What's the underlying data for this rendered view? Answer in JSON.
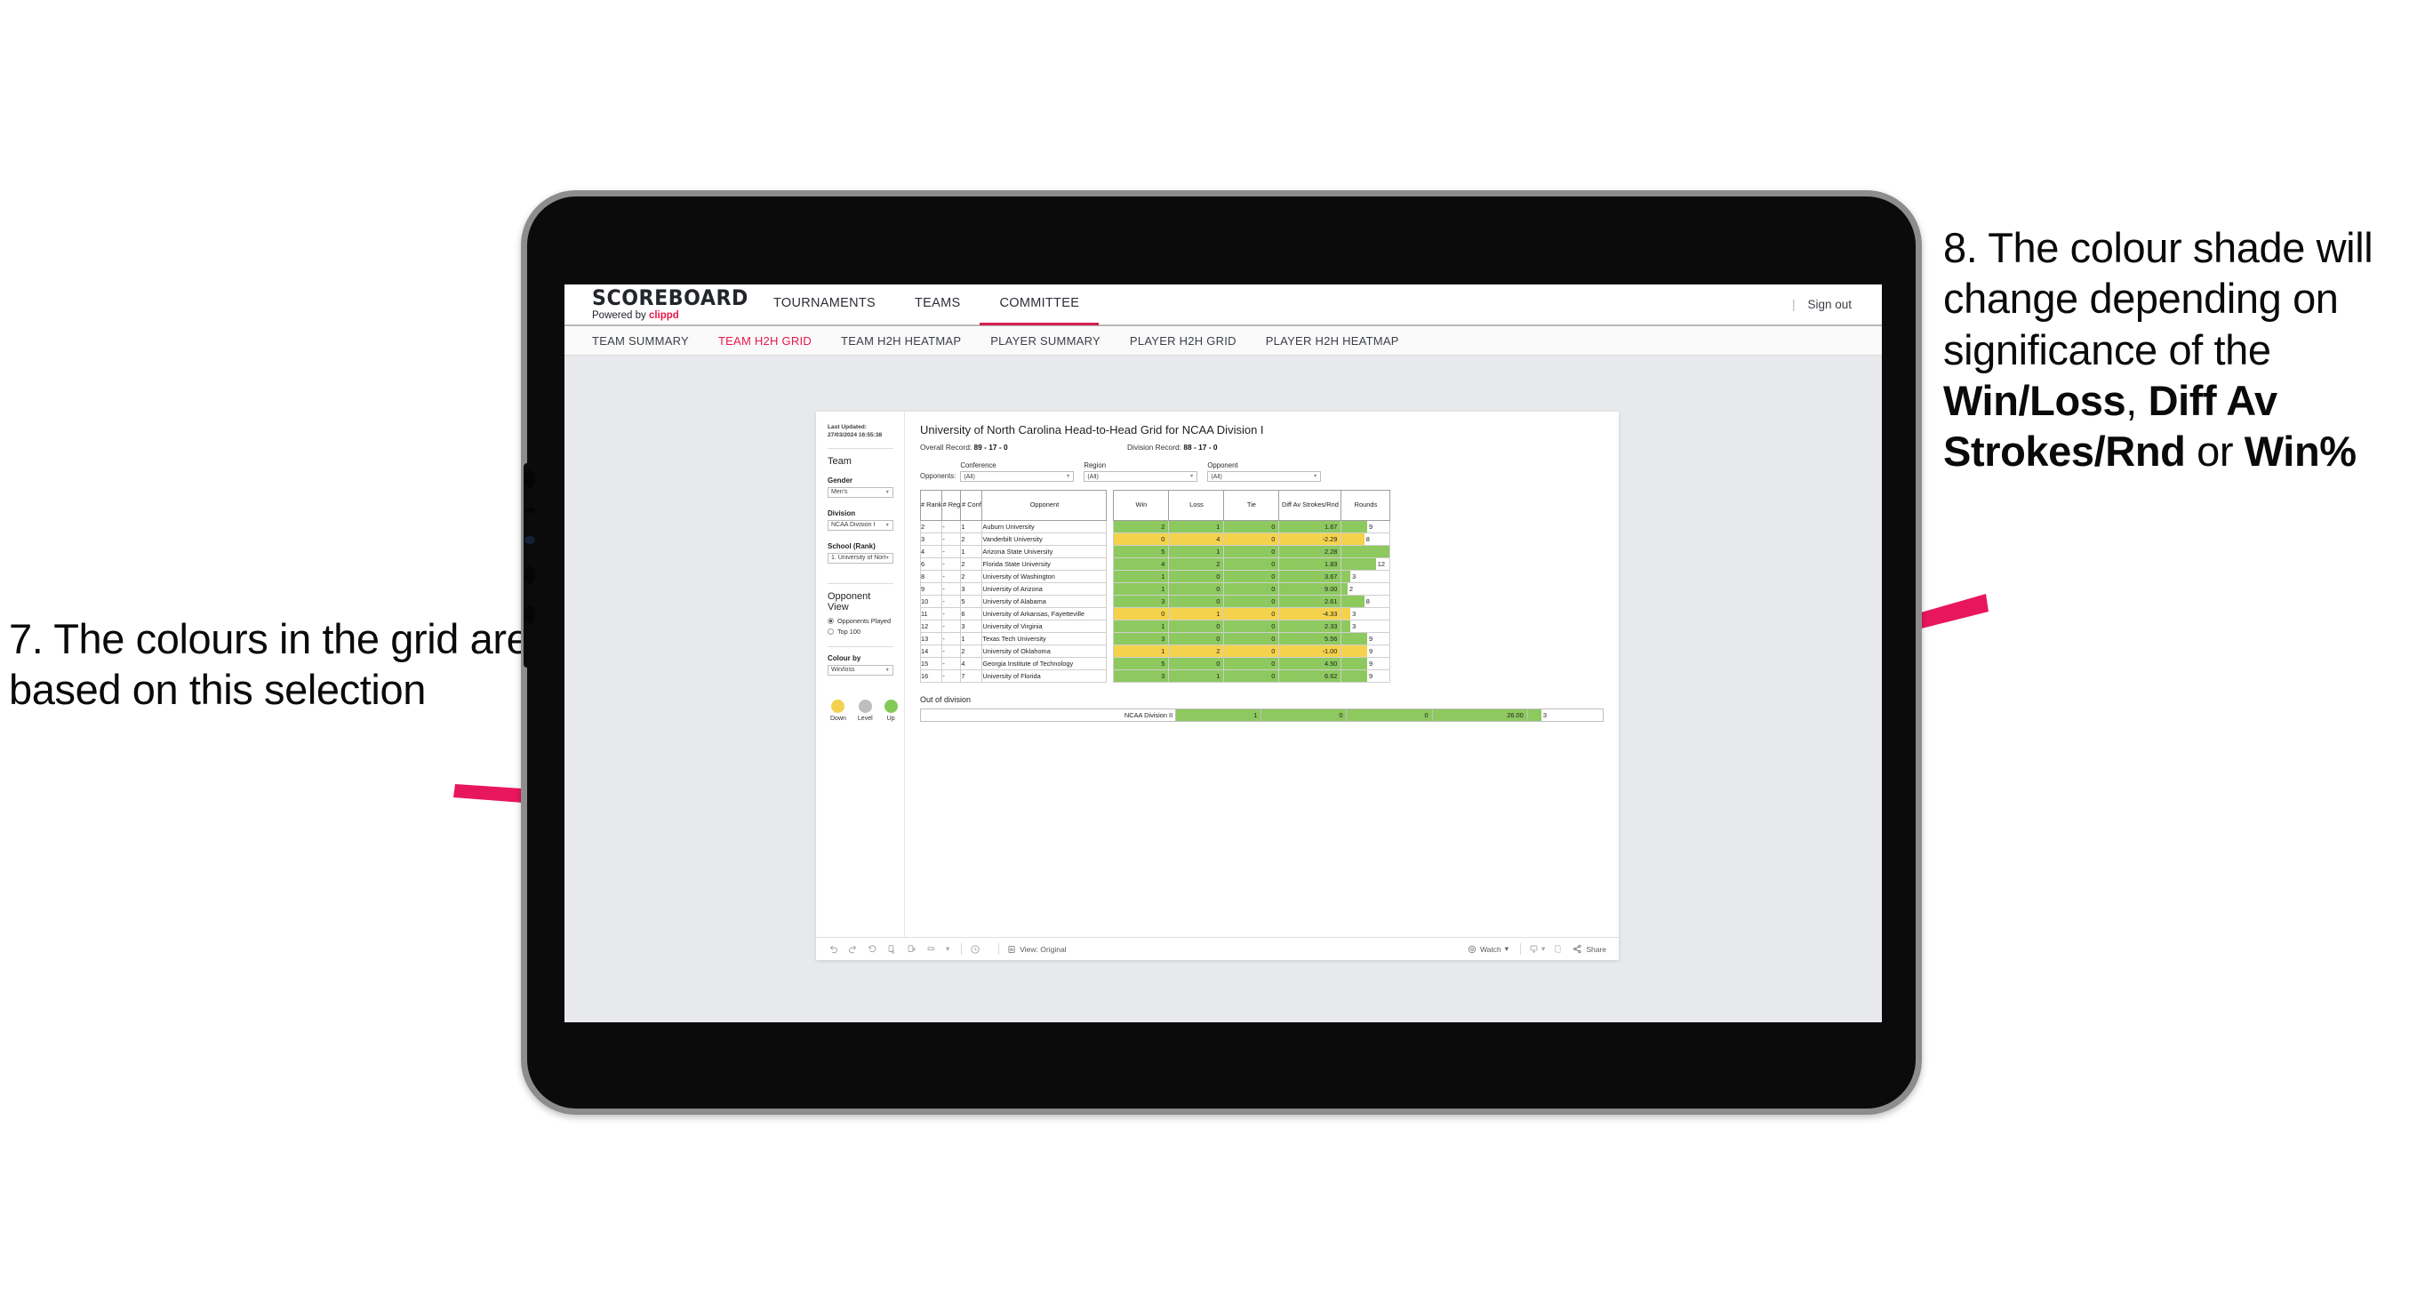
{
  "annotations": {
    "left": {
      "text": "7. The colours in the grid are based on this selection"
    },
    "right": {
      "prefix": "8. The colour shade will change depending on significance of the ",
      "bold1": "Win/Loss",
      "mid1": ", ",
      "bold2": "Diff Av Strokes/Rnd",
      "mid2": " or ",
      "bold3": "Win%"
    },
    "arrow_color": "#e8175d"
  },
  "app": {
    "brand_title": "SCOREBOARD",
    "brand_sub_prefix": "Powered by ",
    "brand_sub_name": "clippd",
    "topnav": [
      {
        "label": "TOURNAMENTS",
        "active": false
      },
      {
        "label": "TEAMS",
        "active": false
      },
      {
        "label": "COMMITTEE",
        "active": true
      }
    ],
    "signout_sep": "|",
    "signout_label": "Sign out",
    "subnav": [
      {
        "label": "TEAM SUMMARY",
        "active": false
      },
      {
        "label": "TEAM H2H GRID",
        "active": true
      },
      {
        "label": "TEAM H2H HEATMAP",
        "active": false
      },
      {
        "label": "PLAYER SUMMARY",
        "active": false
      },
      {
        "label": "PLAYER H2H GRID",
        "active": false
      },
      {
        "label": "PLAYER H2H HEATMAP",
        "active": false
      }
    ],
    "accent": "#e8174a"
  },
  "sidebar": {
    "last_updated": "Last Updated: 27/03/2024 16:55:38",
    "team_heading": "Team",
    "gender": {
      "label": "Gender",
      "value": "Men's"
    },
    "division": {
      "label": "Division",
      "value": "NCAA Division I"
    },
    "school": {
      "label": "School (Rank)",
      "value": "1. University of Nort..."
    },
    "opponent_view": {
      "heading": "Opponent View",
      "options": [
        {
          "label": "Opponents Played",
          "selected": true
        },
        {
          "label": "Top 100",
          "selected": false
        }
      ]
    },
    "colour_by": {
      "label": "Colour by",
      "value": "Win/loss"
    },
    "legend": [
      {
        "label": "Down",
        "color": "#f3d14f"
      },
      {
        "label": "Level",
        "color": "#bcbec0"
      },
      {
        "label": "Up",
        "color": "#84ca58"
      }
    ]
  },
  "main": {
    "title": "University of North Carolina Head-to-Head Grid for NCAA Division I",
    "overall_record_label": "Overall Record: ",
    "overall_record_value": "89 - 17 - 0",
    "division_record_label": "Division Record: ",
    "division_record_value": "88 - 17 - 0",
    "opponents_label": "Opponents:",
    "filters": [
      {
        "label": "Conference",
        "value": "(All)"
      },
      {
        "label": "Region",
        "value": "(All)"
      },
      {
        "label": "Opponent",
        "value": "(All)"
      }
    ],
    "out_of_division_title": "Out of division"
  },
  "chart_data": {
    "type": "table",
    "title": "University of North Carolina Head-to-Head Grid for NCAA Division I",
    "columns": [
      "# Rank",
      "# Reg",
      "# Conf",
      "Opponent",
      "Win",
      "Loss",
      "Tie",
      "Diff Av Strokes/Rnd",
      "Rounds"
    ],
    "colour_by": "Win/loss",
    "colors": {
      "up": "#8dc95f",
      "down": "#f4d24c",
      "level": "#bcbec0"
    },
    "rounds_max": 17,
    "rows": [
      {
        "rank": "2",
        "reg": "-",
        "conf": "1",
        "opponent": "Auburn University",
        "win": 2,
        "loss": 1,
        "tie": 0,
        "diff": "1.67",
        "rounds": 9,
        "state": "up"
      },
      {
        "rank": "3",
        "reg": "-",
        "conf": "2",
        "opponent": "Vanderbilt University",
        "win": 0,
        "loss": 4,
        "tie": 0,
        "diff": "-2.29",
        "rounds": 8,
        "state": "down"
      },
      {
        "rank": "4",
        "reg": "-",
        "conf": "1",
        "opponent": "Arizona State University",
        "win": 5,
        "loss": 1,
        "tie": 0,
        "diff": "2.28",
        "rounds": 17,
        "state": "up"
      },
      {
        "rank": "6",
        "reg": "-",
        "conf": "2",
        "opponent": "Florida State University",
        "win": 4,
        "loss": 2,
        "tie": 0,
        "diff": "1.83",
        "rounds": 12,
        "state": "up"
      },
      {
        "rank": "8",
        "reg": "-",
        "conf": "2",
        "opponent": "University of Washington",
        "win": 1,
        "loss": 0,
        "tie": 0,
        "diff": "3.67",
        "rounds": 3,
        "state": "up"
      },
      {
        "rank": "9",
        "reg": "-",
        "conf": "3",
        "opponent": "University of Arizona",
        "win": 1,
        "loss": 0,
        "tie": 0,
        "diff": "9.00",
        "rounds": 2,
        "state": "up"
      },
      {
        "rank": "10",
        "reg": "-",
        "conf": "5",
        "opponent": "University of Alabama",
        "win": 3,
        "loss": 0,
        "tie": 0,
        "diff": "2.61",
        "rounds": 8,
        "state": "up"
      },
      {
        "rank": "11",
        "reg": "-",
        "conf": "6",
        "opponent": "University of Arkansas, Fayetteville",
        "win": 0,
        "loss": 1,
        "tie": 0,
        "diff": "-4.33",
        "rounds": 3,
        "state": "down"
      },
      {
        "rank": "12",
        "reg": "-",
        "conf": "3",
        "opponent": "University of Virginia",
        "win": 1,
        "loss": 0,
        "tie": 0,
        "diff": "2.33",
        "rounds": 3,
        "state": "up"
      },
      {
        "rank": "13",
        "reg": "-",
        "conf": "1",
        "opponent": "Texas Tech University",
        "win": 3,
        "loss": 0,
        "tie": 0,
        "diff": "5.56",
        "rounds": 9,
        "state": "up"
      },
      {
        "rank": "14",
        "reg": "-",
        "conf": "2",
        "opponent": "University of Oklahoma",
        "win": 1,
        "loss": 2,
        "tie": 0,
        "diff": "-1.00",
        "rounds": 9,
        "state": "down"
      },
      {
        "rank": "15",
        "reg": "-",
        "conf": "4",
        "opponent": "Georgia Institute of Technology",
        "win": 5,
        "loss": 0,
        "tie": 0,
        "diff": "4.50",
        "rounds": 9,
        "state": "up"
      },
      {
        "rank": "16",
        "reg": "-",
        "conf": "7",
        "opponent": "University of Florida",
        "win": 3,
        "loss": 1,
        "tie": 0,
        "diff": "6.62",
        "rounds": 9,
        "state": "up"
      }
    ],
    "out_of_division": [
      {
        "opponent": "NCAA Division II",
        "win": 1,
        "loss": 0,
        "tie": 0,
        "diff": "26.00",
        "rounds": 3,
        "state": "up"
      }
    ]
  },
  "toolbar": {
    "view_label": "View: Original",
    "watch_label": "Watch",
    "share_label": "Share"
  }
}
